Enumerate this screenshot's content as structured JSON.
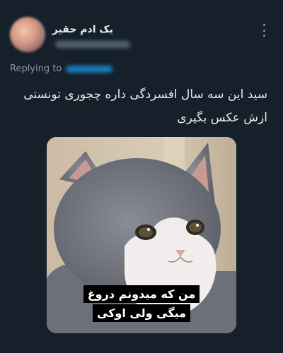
{
  "tweet": {
    "display_name": "یک ادم حقیر",
    "replying_to_label": "Replying to",
    "text_line1": "سید این سه سال افسردگی داره چجوری تونستی",
    "text_line2": "ازش عکس بگیری",
    "media": {
      "caption_line1": "من که میدونم دروغ",
      "caption_line2": "میگی ولی اوکی"
    }
  },
  "icons": {
    "more": "more-vertical-icon"
  },
  "colors": {
    "background": "#15202b",
    "text": "#e7e9ea",
    "secondary_text": "#8b98a5",
    "link": "#1d9bf0"
  }
}
